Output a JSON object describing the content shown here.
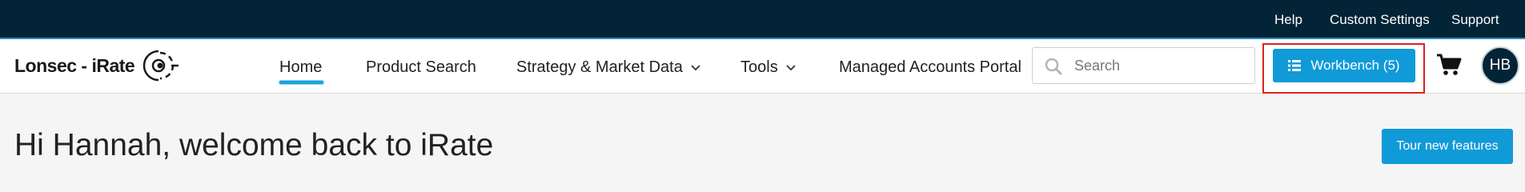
{
  "top_links": [
    "Help",
    "Custom Settings",
    "Support"
  ],
  "logo": {
    "text": "Lonsec - iRate",
    "icon": "eye-target-icon"
  },
  "nav": {
    "items": [
      {
        "label": "Home",
        "active": true
      },
      {
        "label": "Product Search"
      },
      {
        "label": "Strategy & Market Data",
        "dropdown": true
      },
      {
        "label": "Tools",
        "dropdown": true
      },
      {
        "label": "Managed Accounts Portal"
      }
    ]
  },
  "search": {
    "placeholder": "Search",
    "value": "",
    "icon": "search-icon"
  },
  "workbench": {
    "label": "Workbench (5)",
    "icon": "list-icon"
  },
  "cart": {
    "icon": "cart-icon"
  },
  "avatar": {
    "initials": "HB"
  },
  "main": {
    "greeting": "Hi Hannah, welcome back to iRate",
    "tour_button": "Tour new features"
  },
  "colors": {
    "top_bar": "#022436",
    "accent": "#109ad8",
    "highlight": "#e02020",
    "background": "#f5f5f5"
  }
}
